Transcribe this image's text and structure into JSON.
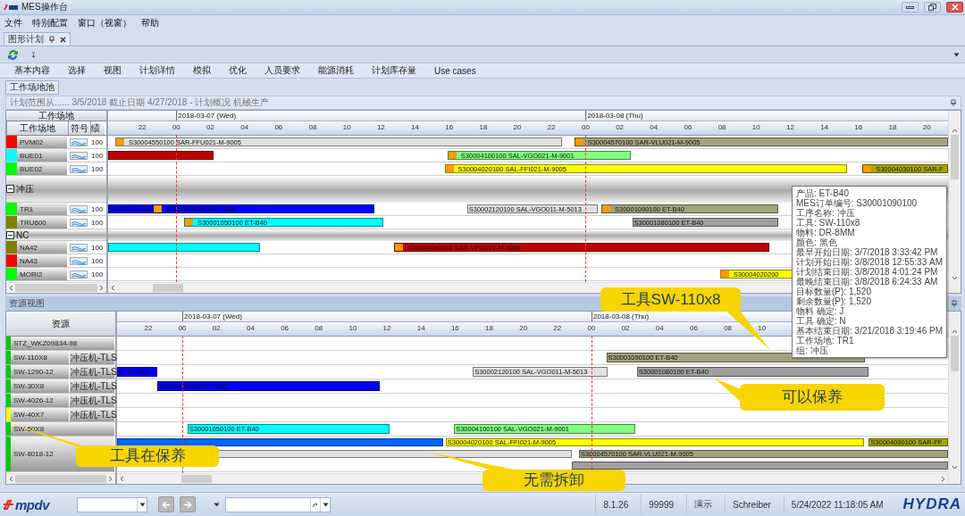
{
  "window": {
    "title": "MES操作台"
  },
  "menu": [
    "文件",
    "特别配置",
    "窗口（视窗）",
    "帮助"
  ],
  "doc_tabs": [
    {
      "label": "图形计划",
      "selected": true
    }
  ],
  "ribbon_tabs": [
    {
      "label": "基本内容",
      "selected": false
    },
    {
      "label": "选择",
      "selected": false
    },
    {
      "label": "视图",
      "selected": false
    },
    {
      "label": "计划详情",
      "selected": false
    },
    {
      "label": "模拟",
      "selected": false
    },
    {
      "label": "优化",
      "selected": false
    },
    {
      "label": "人员要求",
      "selected": false
    },
    {
      "label": "能源消耗",
      "selected": false
    },
    {
      "label": "计划库存量",
      "selected": false
    },
    {
      "label": "Use cases",
      "selected": false
    }
  ],
  "pool_button": "工作场地池",
  "plan_info": "计划范围从...... 3/5/2018 截止日期 4/27/2018  - 计划概况 机械生产",
  "workplace_gantt": {
    "group_header": "工作场地",
    "columns": [
      "工作场地",
      "符号",
      "绩"
    ],
    "axis": {
      "dates": [
        "2018-03-07 (Wed)",
        "2018-03-08 (Thu)"
      ],
      "ticks": [
        "22",
        "00",
        "02",
        "04",
        "06",
        "08",
        "10",
        "12",
        "14",
        "16",
        "18",
        "20",
        "22",
        "00",
        "02",
        "04",
        "06",
        "08",
        "10",
        "12",
        "14",
        "16",
        "18",
        "20"
      ]
    },
    "rows": [
      {
        "kind": "resource",
        "name": "PVM02",
        "color": "#ff0000",
        "performance": "100",
        "bars": [
          {
            "text": "S30004550100 SAR-FFU021-M-9005",
            "color": "#e0e0e0",
            "lead": true
          },
          {
            "text": "S30004570100 SAR-VLU021-M-9005",
            "color": "#a3a37f",
            "lead": true
          }
        ]
      },
      {
        "kind": "resource",
        "name": "BUE01",
        "color": "#00ffff",
        "performance": "100",
        "bars": [
          {
            "color": "#c00000",
            "lead": false
          },
          {
            "text": "S30004100100 SAL-VGO021-M-9001",
            "color": "#80ff80",
            "lead": true
          }
        ]
      },
      {
        "kind": "resource",
        "name": "BUE02",
        "color": "#00ff00",
        "performance": "100",
        "bars": [
          {
            "text": "S30004020100 SAL-FFI021-M-9005",
            "color": "#ffff00",
            "lead": true
          },
          {
            "text": "S30004030100 SAR-F",
            "color": "#a8a800",
            "lead": true
          }
        ]
      },
      {
        "kind": "group",
        "label": "冲压",
        "expanded": true
      },
      {
        "kind": "resource",
        "name": "TR1",
        "color": "#00ff00",
        "performance": "100",
        "bars": [
          {
            "text": "R-VGO011-M-",
            "color": "#0000ff",
            "lead": false
          },
          {
            "text": "S30001060100 ET-B40",
            "color": "#0000ff",
            "lead": true
          },
          {
            "text": "S30002120100 SAL-VGO011-M-5013",
            "color": "#e0e0e0",
            "lead": false
          },
          {
            "text": "S30001090100 ET-B40",
            "color": "#a3a37f",
            "lead": true
          }
        ]
      },
      {
        "kind": "resource",
        "name": "TRU600",
        "color": "#808000",
        "performance": "100",
        "bars": [
          {
            "text": "S30001050100 ET-B40",
            "color": "#00ffff",
            "lead": true
          },
          {
            "text": "S30001080100 ET-B40",
            "color": "#a0a0a0",
            "lead": false
          }
        ]
      },
      {
        "kind": "group",
        "label": "NC",
        "expanded": true
      },
      {
        "kind": "resource",
        "name": "NA42",
        "color": "#808000",
        "performance": "100",
        "bars": [
          {
            "color": "#00ffff",
            "lead": false
          },
          {
            "text": "S30004090100 SAR-VPO021-M-9005",
            "color": "#c00000",
            "lead": true
          }
        ]
      },
      {
        "kind": "resource",
        "name": "NA43",
        "color": "#ff0000",
        "performance": "100"
      },
      {
        "kind": "resource",
        "name": "MORI2",
        "color": "#00ff00",
        "performance": "100",
        "bars": [
          {
            "text": "S30004020200",
            "color": "#ffff00",
            "lead": true
          }
        ]
      }
    ]
  },
  "resource_view": {
    "title": "资源视图",
    "header": "资源",
    "axis": {
      "dates": [
        "2018-03-07 (Wed)",
        "2018-03-08 (Thu)"
      ],
      "ticks": [
        "22",
        "00",
        "02",
        "04",
        "06",
        "08",
        "10",
        "12",
        "14",
        "16",
        "18",
        "20",
        "22",
        "00",
        "02",
        "04",
        "06",
        "08",
        "10"
      ]
    },
    "rows": [
      {
        "name": "STZ_WKZ09834-98",
        "color": "#00cc00"
      },
      {
        "name": "SW-110X8",
        "type": "冲压机-TLS",
        "color": "#00cc00",
        "lanes": [
          [
            {
              "text": "S30001090100 ET-B40",
              "color": "#a3a37f"
            }
          ]
        ]
      },
      {
        "name": "SW-1290-12",
        "type": "冲压机-TLS",
        "color": "#00cc00",
        "lanes": [
          [
            {
              "text": "11-M-9001",
              "color": "#0000ff"
            },
            {
              "text": "S30002120100 SAL-VGO011-M-5013",
              "color": "#e0e0e0"
            },
            {
              "text": "S30001080100 ET-B40",
              "color": "#a0a0a0"
            }
          ]
        ]
      },
      {
        "name": "SW-30X8",
        "type": "冲压机-TLS",
        "color": "#00cc00",
        "lanes": [
          [
            {
              "text": "S30001060100 ET-B40",
              "color": "#0000ff"
            }
          ]
        ]
      },
      {
        "name": "SW-4026-12",
        "type": "冲压机-TLS",
        "color": "#00cc00"
      },
      {
        "name": "SW-40X7",
        "type": "冲压机-TLS",
        "color": "#ffff00"
      },
      {
        "name": "SW-50X8",
        "color": "#00cc00",
        "lanes": [
          [
            {
              "text": "S30001050100 ET-B40",
              "color": "#00ffff"
            },
            {
              "text": "S30004100100 SAL-VGO021-M-9001",
              "color": "#80ff80"
            }
          ]
        ]
      },
      {
        "name": "SW-8018-12",
        "color": "#00cc00",
        "lanes": [
          [
            {
              "color": "#0066ff"
            },
            {
              "text": "S30004020100 SAL-FFI021-M-9005",
              "color": "#ffff00"
            },
            {
              "text": "S30004030100 SAR-FF",
              "color": "#a8a800"
            }
          ],
          [
            {
              "color": "#e0e0e0"
            },
            {
              "text": "S30004570100 SAR-VLU021-M-9005",
              "color": "#a3a37f"
            }
          ],
          [
            {
              "color": "#a0a0a0"
            }
          ]
        ]
      }
    ]
  },
  "tooltip": [
    "产品: ET-B40",
    "MES订单编号: S30001090100",
    "工序名称: 冲压",
    "工具: SW-110x8",
    "物料: DR-8MM",
    "颜色: 黑色",
    "最早开始日期: 3/7/2018 3:33:42 PM",
    "计划开始日期: 3/8/2018 12:55:33 AM",
    "计划结束日期: 3/8/2018 4:01:24 PM",
    "最晚结束日期: 3/8/2018 6:24:33 AM",
    "目标数量(P): 1,520",
    "剩余数量(P): 1,520",
    "物料 确定: J",
    "工具 确定: N",
    "基本结束日期: 3/21/2018 3:19:46 PM",
    "工作场地: TR1",
    "组: 冲压"
  ],
  "callouts": [
    "工具SW-110x8",
    "可以保养",
    "工具在保养",
    "无需拆卸"
  ],
  "status_bar": {
    "vendor_logo": "mpdv",
    "fields": [
      "8.1.26",
      "99999",
      "演示",
      "Schreiber",
      "5/24/2022 11:18:05 AM"
    ],
    "product_logo": "HYDRA"
  }
}
